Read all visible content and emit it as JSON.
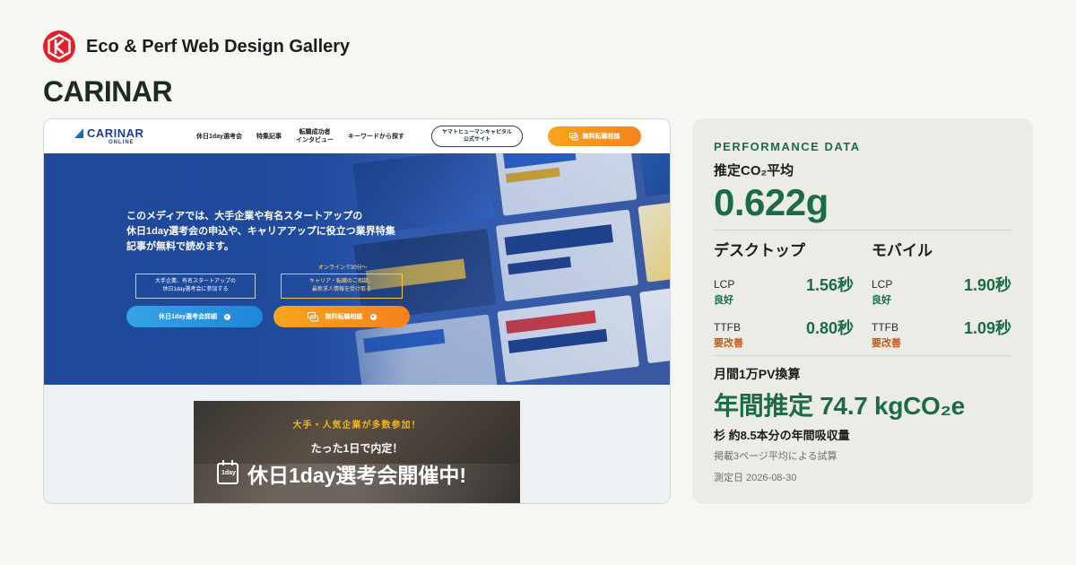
{
  "header": {
    "gallery_name": "Eco & Perf Web Design Gallery",
    "site_title": "CARINAR"
  },
  "screenshot": {
    "nav": {
      "logo_main": "CARINAR",
      "logo_sub": "ONLINE",
      "menu": [
        "休日1day選考会",
        "特集記事",
        "転職成功者\nインタビュー",
        "キーワードから探す"
      ],
      "pill_line1": "ヤマトヒューマンキャピタル",
      "pill_line2": "公式サイト",
      "cta": "無料転職相談"
    },
    "hero": {
      "line1": "このメディアでは、大手企業や有名スタートアップの",
      "line2": "休日1day選考会の申込や、キャリアアップに役立つ業界特集",
      "line3": "記事が無料で読めます。",
      "box1_line1": "大手企業、有名スタートアップの",
      "box1_line2": "休日1day選考会に参加する",
      "box2_note": "オンラインで30分〜",
      "box2_line1": "キャリア・転職のご相談、",
      "box2_line2": "最新求人情報を受け取る",
      "button1": "休日1day選考会詳細",
      "button2": "無料転職相談"
    },
    "banner": {
      "line1": "大手・人気企業が多数参加！",
      "line2": "たった1日で内定！",
      "line3": "休日1day選考会開催中!",
      "icon_text": "1day"
    }
  },
  "performance": {
    "eyebrow": "PERFORMANCE DATA",
    "co2_label": "推定CO₂平均",
    "co2_value": "0.622g",
    "desktop": {
      "title": "デスクトップ",
      "lcp": {
        "name": "LCP",
        "value": "1.56秒",
        "status": "良好"
      },
      "ttfb": {
        "name": "TTFB",
        "value": "0.80秒",
        "status": "要改善"
      }
    },
    "mobile": {
      "title": "モバイル",
      "lcp": {
        "name": "LCP",
        "value": "1.90秒",
        "status": "良好"
      },
      "ttfb": {
        "name": "TTFB",
        "value": "1.09秒",
        "status": "要改善"
      }
    },
    "monthly_label": "月間1万PV換算",
    "monthly_value": "年間推定 74.7 kgCO₂e",
    "trees": "杉 約8.5本分の年間吸収量",
    "basis": "掲載3ページ平均による試算",
    "measured": "測定日 2026-08-30"
  },
  "colors": {
    "accent_green": "#1b6b45",
    "warn_orange": "#c55a11",
    "brand_red": "#e3202a"
  }
}
